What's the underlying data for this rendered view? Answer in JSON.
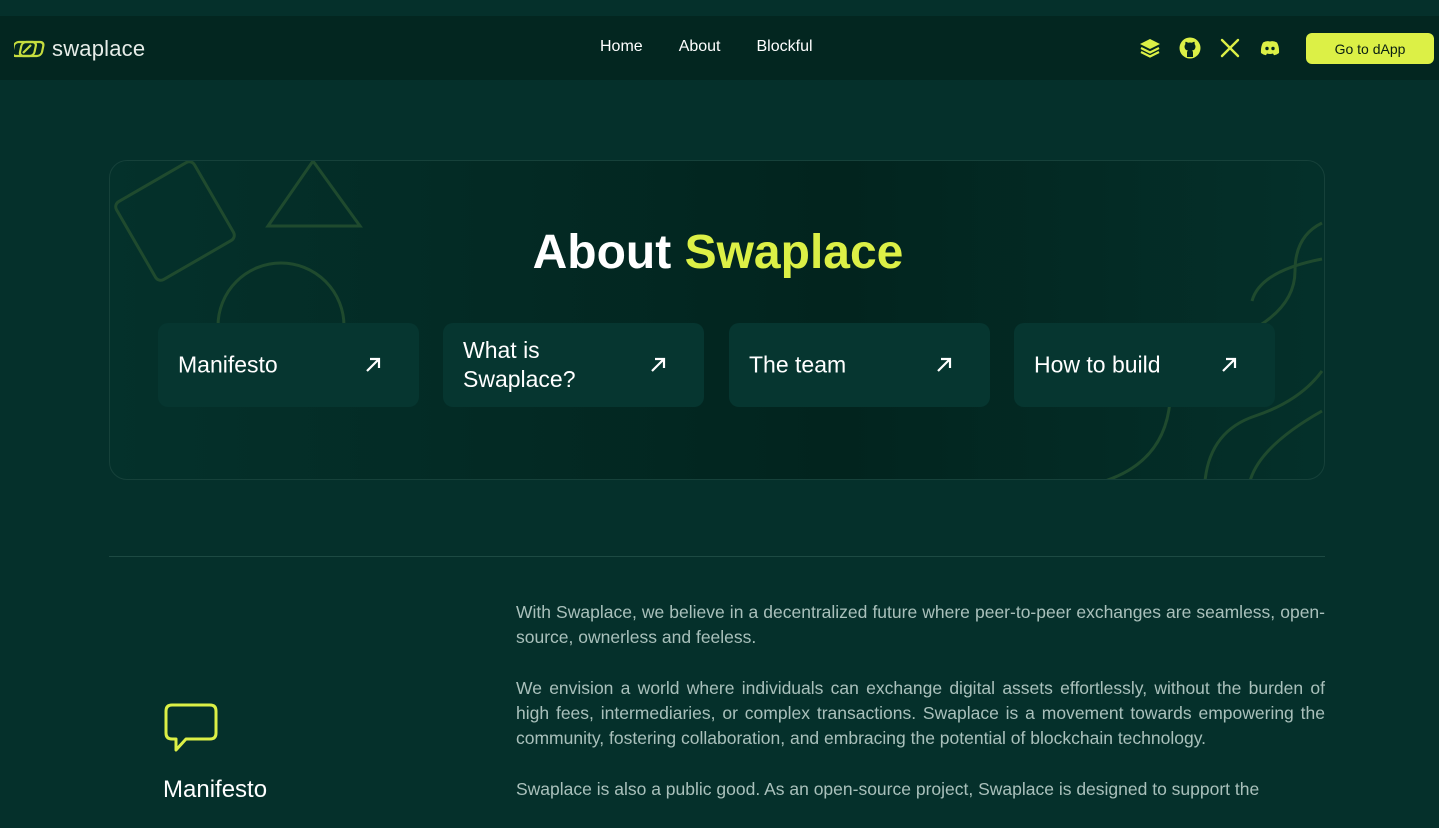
{
  "brand": {
    "name": "swaplace",
    "logo_icon": "swaplace-logo-icon",
    "accent": "#dcf046"
  },
  "nav": {
    "items": [
      "Home",
      "About",
      "Blockful"
    ]
  },
  "social": [
    "stack-icon",
    "github-icon",
    "x-icon",
    "discord-icon"
  ],
  "header": {
    "cta_label": "Go to dApp"
  },
  "hero": {
    "title_main": "About",
    "title_accent": "Swaplace",
    "cards": [
      {
        "label": "Manifesto"
      },
      {
        "label": "What is Swaplace?"
      },
      {
        "label": "The team"
      },
      {
        "label": "How to build"
      }
    ]
  },
  "section": {
    "icon": "speech-bubble-icon",
    "title": "Manifesto",
    "paragraphs": [
      "With Swaplace, we believe in a decentralized future where peer-to-peer exchanges are seamless, open-source, ownerless and feeless.",
      "We envision a world where individuals can exchange digital assets effortlessly, without the burden of high fees, intermediaries, or complex transactions. Swaplace is a movement towards empowering the community, fostering collaboration, and embracing the potential of blockchain technology.",
      "Swaplace is also a public good. As an open-source project, Swaplace is designed to support the"
    ]
  }
}
